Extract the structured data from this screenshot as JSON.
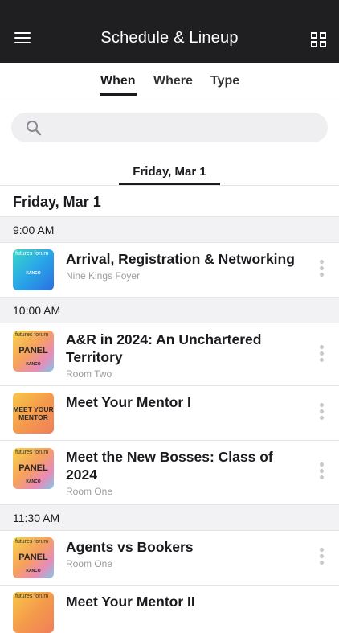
{
  "header": {
    "title": "Schedule & Lineup"
  },
  "filter_tabs": [
    {
      "label": "When",
      "active": true
    },
    {
      "label": "Where",
      "active": false
    },
    {
      "label": "Type",
      "active": false
    }
  ],
  "search": {
    "placeholder": ""
  },
  "date_tabs": [
    {
      "label": "Friday, Mar 1",
      "active": true
    }
  ],
  "day_heading": "Friday, Mar 1",
  "time_groups": [
    {
      "time": "9:00 AM"
    },
    {
      "time": "10:00 AM"
    },
    {
      "time": "11:30 AM"
    }
  ],
  "sessions": [
    {
      "title": "Arrival, Registration & Networking",
      "location": "Nine Kings Foyer",
      "thumb_text": "",
      "thumb_brand": "futures forum",
      "thumb_logo": "KANCO"
    },
    {
      "title": "A&R in 2024: An Unchartered Territory",
      "location": "Room Two",
      "thumb_text": "PANEL",
      "thumb_brand": "futures forum",
      "thumb_logo": "KANCO"
    },
    {
      "title": "Meet Your Mentor I",
      "location": "",
      "thumb_text": "MEET YOUR MENTOR",
      "thumb_brand": "",
      "thumb_logo": ""
    },
    {
      "title": "Meet the New Bosses: Class of 2024",
      "location": "Room One",
      "thumb_text": "PANEL",
      "thumb_brand": "futures forum",
      "thumb_logo": "KANCO"
    },
    {
      "title": "Agents vs Bookers",
      "location": "Room One",
      "thumb_text": "PANEL",
      "thumb_brand": "futures forum",
      "thumb_logo": "KANCO"
    },
    {
      "title": "Meet Your Mentor II",
      "location": "",
      "thumb_text": "",
      "thumb_brand": "futures forum",
      "thumb_logo": ""
    }
  ],
  "colors": {
    "appbar": "#1f1f21",
    "accent": "#1b1b1f",
    "section_bg": "#f2f2f4",
    "muted_text": "#9a9aa0"
  }
}
